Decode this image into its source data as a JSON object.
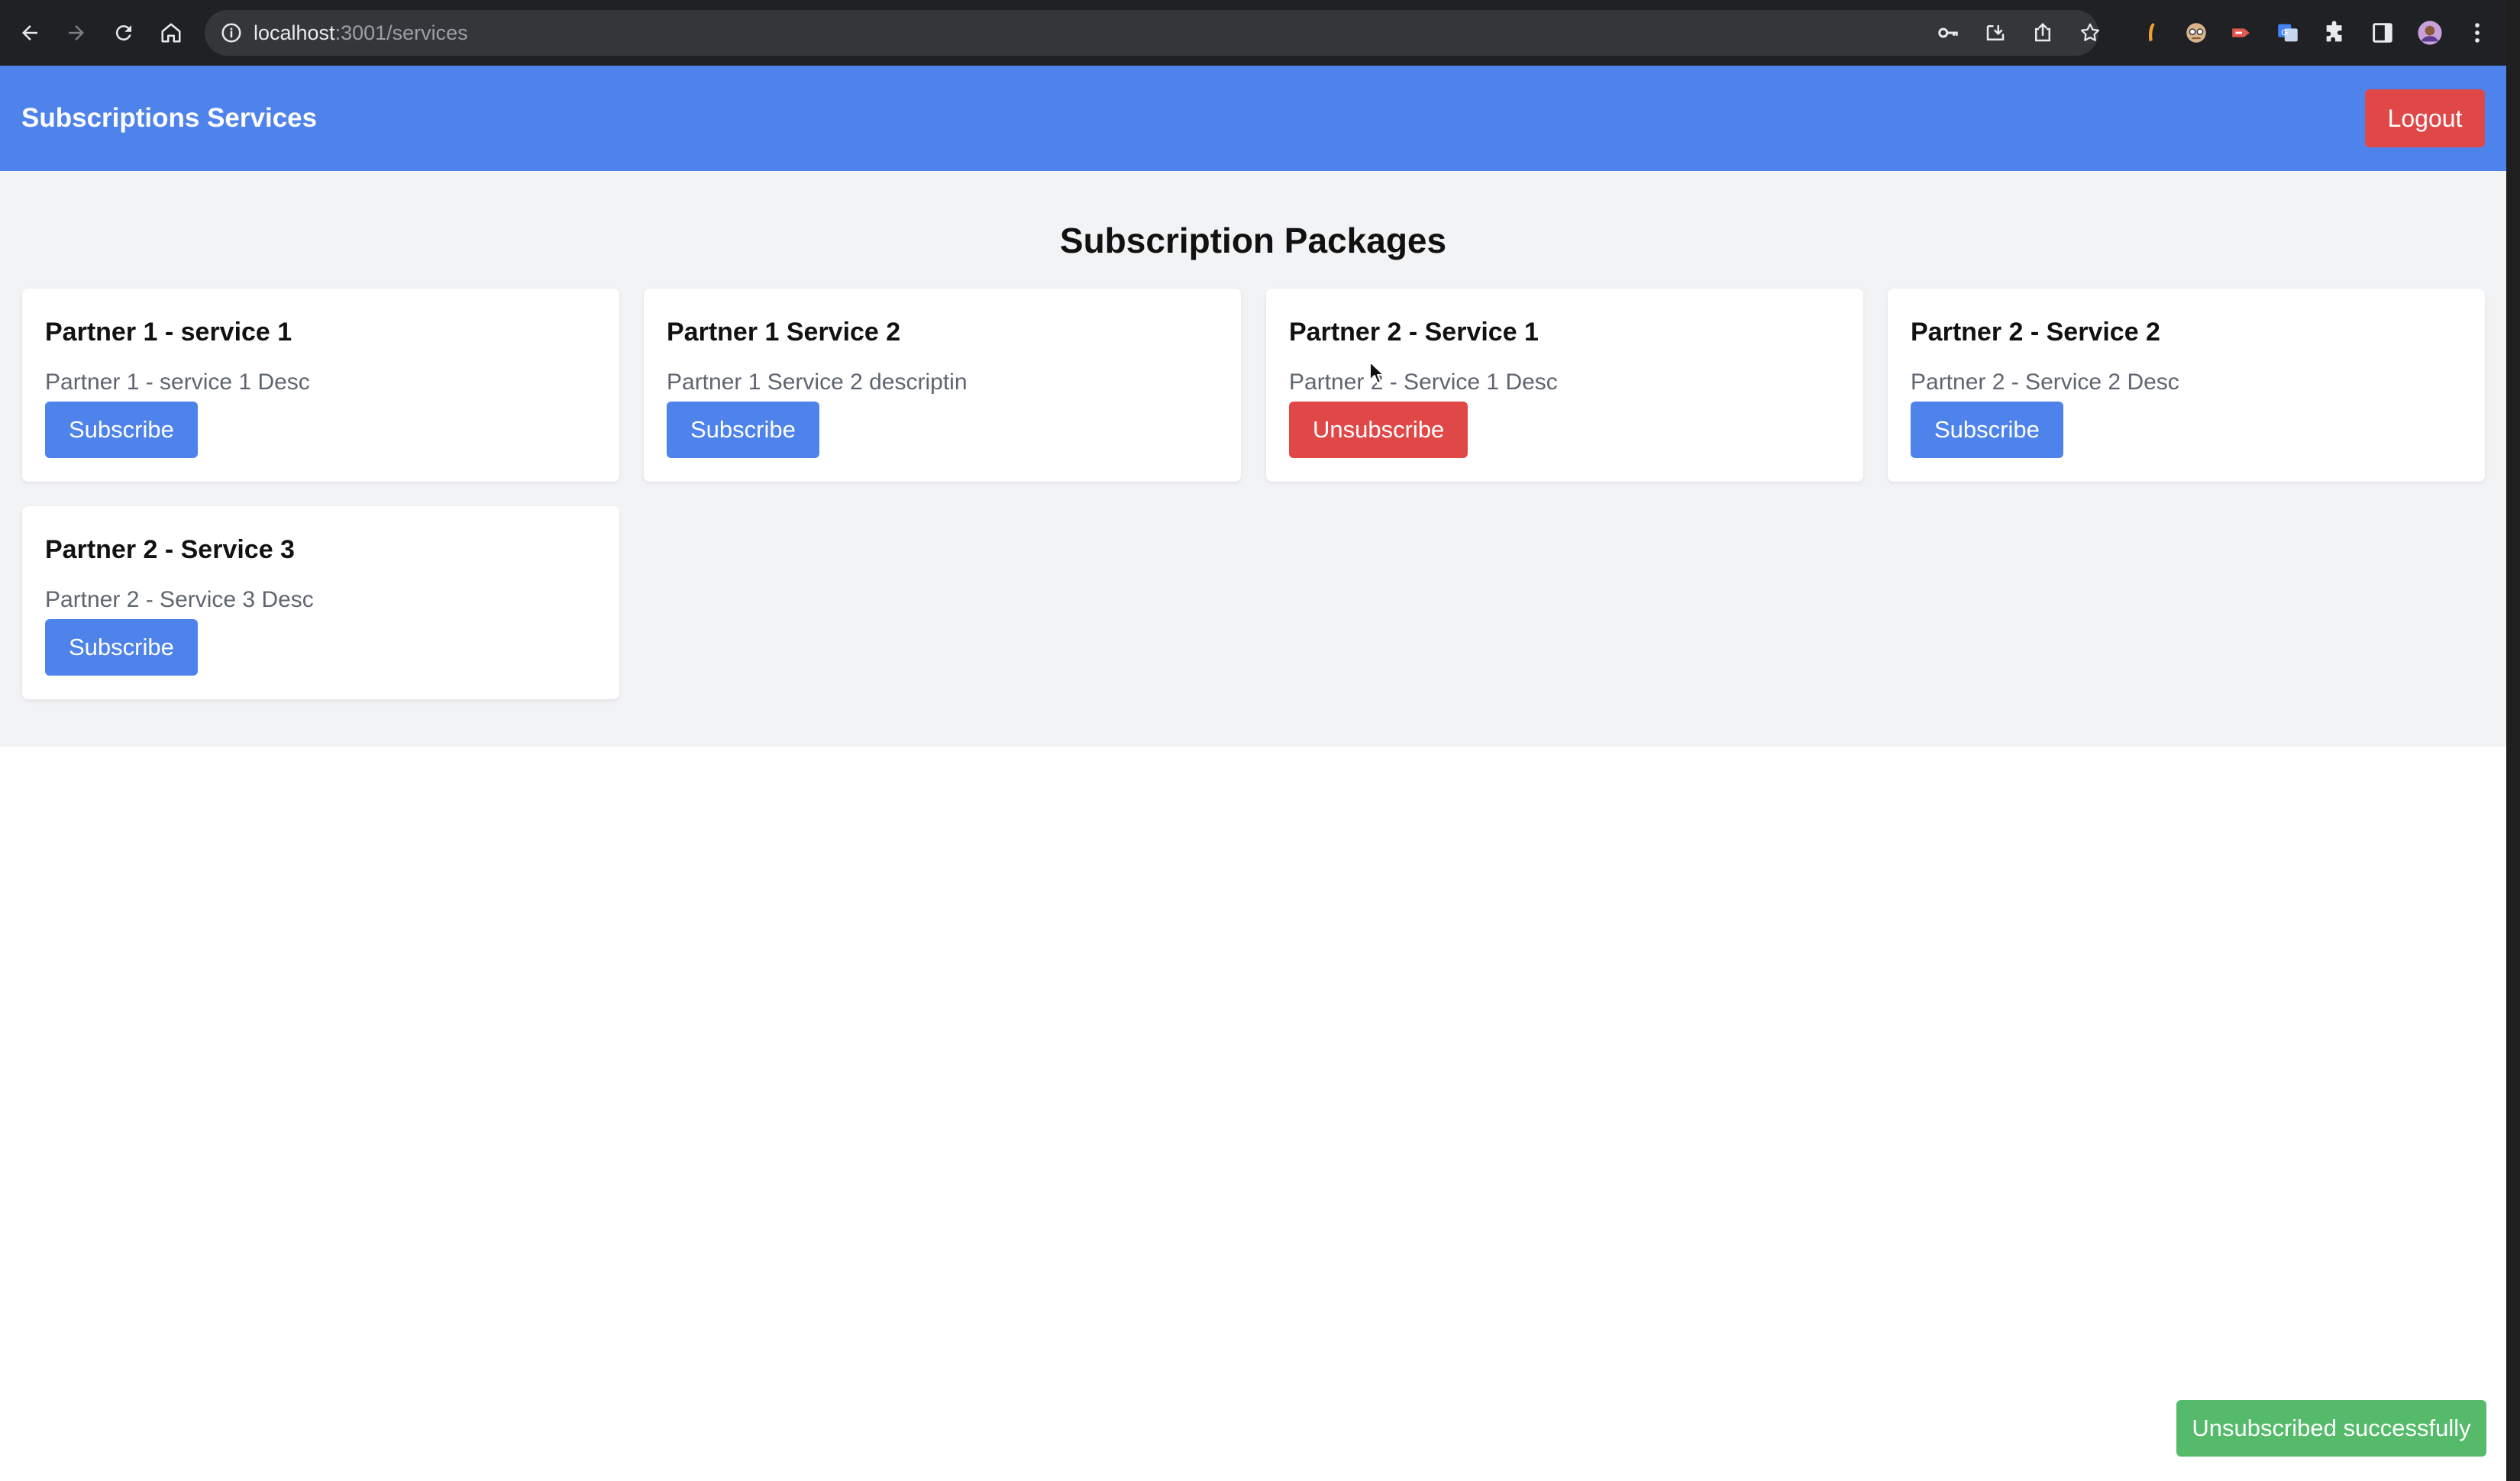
{
  "browser": {
    "url_host": "localhost",
    "url_rest": ":3001/services",
    "nav_icons": [
      "back-icon",
      "forward-icon",
      "reload-icon",
      "home-icon"
    ],
    "omnibox_icons": [
      "site-info-icon",
      "key-icon",
      "install-icon",
      "share-icon",
      "bookmark-star-icon"
    ],
    "extension_icons": [
      "extension-1-icon",
      "extension-2-icon",
      "extension-3-icon",
      "translate-icon",
      "puzzle-icon",
      "side-panel-icon",
      "profile-avatar",
      "more-menu-icon"
    ]
  },
  "header": {
    "title": "Subscriptions Services",
    "logout_label": "Logout",
    "background_color": "#4f83ec",
    "logout_color": "#e04848"
  },
  "main": {
    "heading": "Subscription Packages",
    "cards": [
      {
        "title": "Partner 1 - service 1",
        "description": "Partner 1 - service 1 Desc",
        "button_label": "Subscribe",
        "subscribed": false
      },
      {
        "title": "Partner 1 Service 2",
        "description": "Partner 1 Service 2 descriptin",
        "button_label": "Subscribe",
        "subscribed": false
      },
      {
        "title": "Partner 2 - Service 1",
        "description": "Partner 2 - Service 1 Desc",
        "button_label": "Unsubscribe",
        "subscribed": true
      },
      {
        "title": "Partner 2 - Service 2",
        "description": "Partner 2 - Service 2 Desc",
        "button_label": "Subscribe",
        "subscribed": false
      },
      {
        "title": "Partner 2 - Service 3",
        "description": "Partner 2 - Service 3 Desc",
        "button_label": "Subscribe",
        "subscribed": false
      }
    ]
  },
  "toast": {
    "message": "Unsubscribed successfully",
    "color": "#55bb6b"
  }
}
